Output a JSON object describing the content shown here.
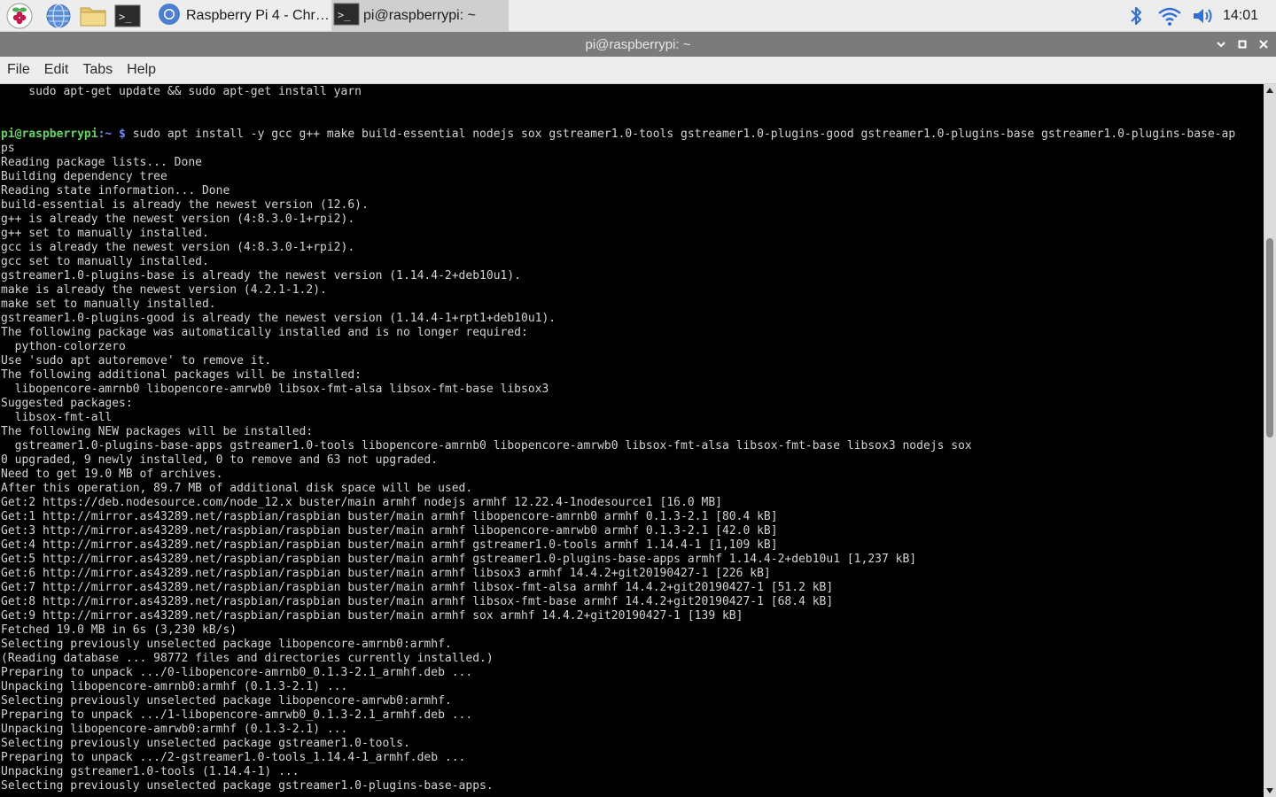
{
  "taskbar": {
    "launchers": [
      {
        "icon": "raspberry-menu-icon"
      },
      {
        "icon": "web-browser-icon"
      },
      {
        "icon": "file-manager-icon"
      },
      {
        "icon": "terminal-icon"
      }
    ],
    "tasks": [
      {
        "label": "Raspberry Pi 4 - Chro…",
        "icon": "chromium-icon",
        "active": false
      },
      {
        "label": "pi@raspberrypi: ~",
        "icon": "terminal-icon",
        "active": true
      }
    ],
    "tray": {
      "bluetooth": "bluetooth-icon",
      "wifi": "wifi-icon",
      "volume": "volume-icon",
      "clock": "14:01"
    }
  },
  "window": {
    "title": "pi@raspberrypi: ~",
    "controls": [
      "minimize",
      "maximize",
      "close"
    ]
  },
  "menu": [
    "File",
    "Edit",
    "Tabs",
    "Help"
  ],
  "terminal": {
    "colors": {
      "prompt_user": "#5fd75f",
      "prompt_path": "#6b8cff",
      "text": "#d3d3d3",
      "background": "#000000"
    },
    "prompt": {
      "user": "pi@raspberrypi",
      "path": ":~ $"
    },
    "lines": [
      {
        "text": "    sudo apt-get update && sudo apt-get install yarn"
      },
      {
        "text": ""
      },
      {
        "text": ""
      },
      {
        "prompt": true,
        "text": " sudo apt install -y gcc g++ make build-essential nodejs sox gstreamer1.0-tools gstreamer1.0-plugins-good gstreamer1.0-plugins-base gstreamer1.0-plugins-base-ap"
      },
      {
        "text": "ps"
      },
      {
        "text": "Reading package lists... Done"
      },
      {
        "text": "Building dependency tree"
      },
      {
        "text": "Reading state information... Done"
      },
      {
        "text": "build-essential is already the newest version (12.6)."
      },
      {
        "text": "g++ is already the newest version (4:8.3.0-1+rpi2)."
      },
      {
        "text": "g++ set to manually installed."
      },
      {
        "text": "gcc is already the newest version (4:8.3.0-1+rpi2)."
      },
      {
        "text": "gcc set to manually installed."
      },
      {
        "text": "gstreamer1.0-plugins-base is already the newest version (1.14.4-2+deb10u1)."
      },
      {
        "text": "make is already the newest version (4.2.1-1.2)."
      },
      {
        "text": "make set to manually installed."
      },
      {
        "text": "gstreamer1.0-plugins-good is already the newest version (1.14.4-1+rpt1+deb10u1)."
      },
      {
        "text": "The following package was automatically installed and is no longer required:"
      },
      {
        "text": "  python-colorzero"
      },
      {
        "text": "Use 'sudo apt autoremove' to remove it."
      },
      {
        "text": "The following additional packages will be installed:"
      },
      {
        "text": "  libopencore-amrnb0 libopencore-amrwb0 libsox-fmt-alsa libsox-fmt-base libsox3"
      },
      {
        "text": "Suggested packages:"
      },
      {
        "text": "  libsox-fmt-all"
      },
      {
        "text": "The following NEW packages will be installed:"
      },
      {
        "text": "  gstreamer1.0-plugins-base-apps gstreamer1.0-tools libopencore-amrnb0 libopencore-amrwb0 libsox-fmt-alsa libsox-fmt-base libsox3 nodejs sox"
      },
      {
        "text": "0 upgraded, 9 newly installed, 0 to remove and 63 not upgraded."
      },
      {
        "text": "Need to get 19.0 MB of archives."
      },
      {
        "text": "After this operation, 89.7 MB of additional disk space will be used."
      },
      {
        "text": "Get:2 https://deb.nodesource.com/node_12.x buster/main armhf nodejs armhf 12.22.4-1nodesource1 [16.0 MB]"
      },
      {
        "text": "Get:1 http://mirror.as43289.net/raspbian/raspbian buster/main armhf libopencore-amrnb0 armhf 0.1.3-2.1 [80.4 kB]"
      },
      {
        "text": "Get:3 http://mirror.as43289.net/raspbian/raspbian buster/main armhf libopencore-amrwb0 armhf 0.1.3-2.1 [42.0 kB]"
      },
      {
        "text": "Get:4 http://mirror.as43289.net/raspbian/raspbian buster/main armhf gstreamer1.0-tools armhf 1.14.4-1 [1,109 kB]"
      },
      {
        "text": "Get:5 http://mirror.as43289.net/raspbian/raspbian buster/main armhf gstreamer1.0-plugins-base-apps armhf 1.14.4-2+deb10u1 [1,237 kB]"
      },
      {
        "text": "Get:6 http://mirror.as43289.net/raspbian/raspbian buster/main armhf libsox3 armhf 14.4.2+git20190427-1 [226 kB]"
      },
      {
        "text": "Get:7 http://mirror.as43289.net/raspbian/raspbian buster/main armhf libsox-fmt-alsa armhf 14.4.2+git20190427-1 [51.2 kB]"
      },
      {
        "text": "Get:8 http://mirror.as43289.net/raspbian/raspbian buster/main armhf libsox-fmt-base armhf 14.4.2+git20190427-1 [68.4 kB]"
      },
      {
        "text": "Get:9 http://mirror.as43289.net/raspbian/raspbian buster/main armhf sox armhf 14.4.2+git20190427-1 [139 kB]"
      },
      {
        "text": "Fetched 19.0 MB in 6s (3,230 kB/s)"
      },
      {
        "text": "Selecting previously unselected package libopencore-amrnb0:armhf."
      },
      {
        "text": "(Reading database ... 98772 files and directories currently installed.)"
      },
      {
        "text": "Preparing to unpack .../0-libopencore-amrnb0_0.1.3-2.1_armhf.deb ..."
      },
      {
        "text": "Unpacking libopencore-amrnb0:armhf (0.1.3-2.1) ..."
      },
      {
        "text": "Selecting previously unselected package libopencore-amrwb0:armhf."
      },
      {
        "text": "Preparing to unpack .../1-libopencore-amrwb0_0.1.3-2.1_armhf.deb ..."
      },
      {
        "text": "Unpacking libopencore-amrwb0:armhf (0.1.3-2.1) ..."
      },
      {
        "text": "Selecting previously unselected package gstreamer1.0-tools."
      },
      {
        "text": "Preparing to unpack .../2-gstreamer1.0-tools_1.14.4-1_armhf.deb ..."
      },
      {
        "text": "Unpacking gstreamer1.0-tools (1.14.4-1) ..."
      },
      {
        "text": "Selecting previously unselected package gstreamer1.0-plugins-base-apps."
      }
    ]
  },
  "scrollbar": {
    "position": 0.29,
    "visible_fraction": 0.29
  }
}
